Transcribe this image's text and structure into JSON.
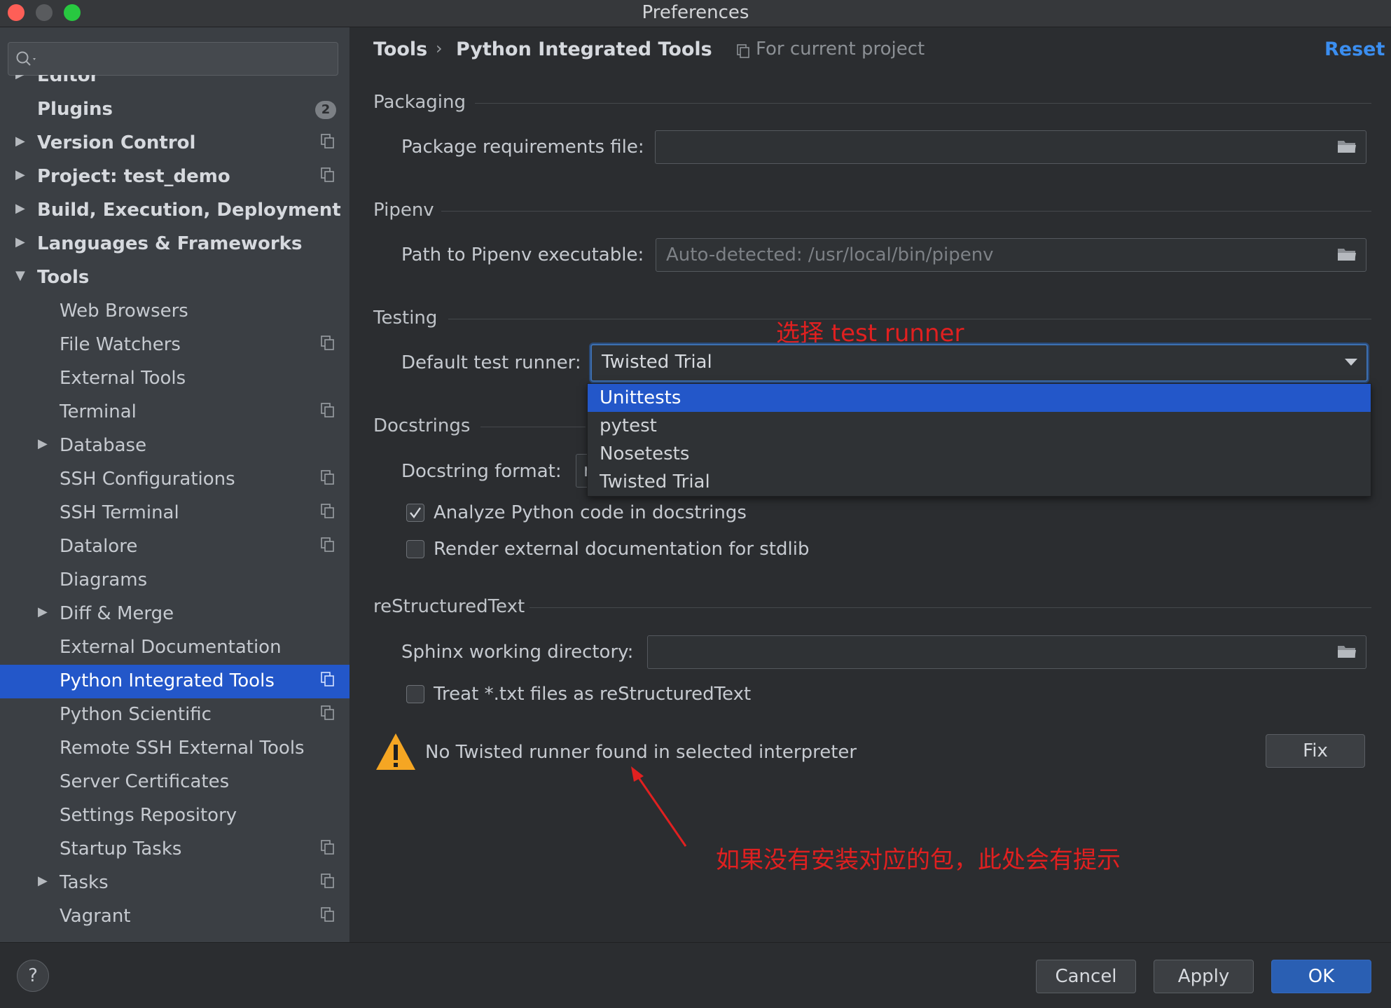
{
  "window": {
    "title": "Preferences"
  },
  "colors": {
    "accent": "#2357c9",
    "link": "#3b8ef0",
    "annotation": "#e02020",
    "warning": "#f5a623"
  },
  "sidebar": {
    "search_placeholder": "",
    "items": [
      {
        "label": "Editor",
        "bold": true,
        "arrow": "collapsed",
        "project_icon": false
      },
      {
        "label": "Plugins",
        "bold": true,
        "arrow": "none",
        "badge": "2"
      },
      {
        "label": "Version Control",
        "bold": true,
        "arrow": "collapsed",
        "project_icon": true
      },
      {
        "label": "Project: test_demo",
        "bold": true,
        "arrow": "collapsed",
        "project_icon": true
      },
      {
        "label": "Build, Execution, Deployment",
        "bold": true,
        "arrow": "collapsed",
        "project_icon": false
      },
      {
        "label": "Languages & Frameworks",
        "bold": true,
        "arrow": "collapsed",
        "project_icon": false
      },
      {
        "label": "Tools",
        "bold": true,
        "arrow": "expanded",
        "project_icon": false
      },
      {
        "label": "Web Browsers",
        "arrow": "none",
        "project_icon": false
      },
      {
        "label": "File Watchers",
        "arrow": "none",
        "project_icon": true
      },
      {
        "label": "External Tools",
        "arrow": "none",
        "project_icon": false
      },
      {
        "label": "Terminal",
        "arrow": "none",
        "project_icon": true
      },
      {
        "label": "Database",
        "arrow": "collapsed",
        "project_icon": false
      },
      {
        "label": "SSH Configurations",
        "arrow": "none",
        "project_icon": true
      },
      {
        "label": "SSH Terminal",
        "arrow": "none",
        "project_icon": true
      },
      {
        "label": "Datalore",
        "arrow": "none",
        "project_icon": true
      },
      {
        "label": "Diagrams",
        "arrow": "none",
        "project_icon": false
      },
      {
        "label": "Diff & Merge",
        "arrow": "collapsed",
        "project_icon": false
      },
      {
        "label": "External Documentation",
        "arrow": "none",
        "project_icon": false
      },
      {
        "label": "Python Integrated Tools",
        "arrow": "none",
        "project_icon": true,
        "selected": true
      },
      {
        "label": "Python Scientific",
        "arrow": "none",
        "project_icon": true
      },
      {
        "label": "Remote SSH External Tools",
        "arrow": "none",
        "project_icon": false
      },
      {
        "label": "Server Certificates",
        "arrow": "none",
        "project_icon": false
      },
      {
        "label": "Settings Repository",
        "arrow": "none",
        "project_icon": false
      },
      {
        "label": "Startup Tasks",
        "arrow": "none",
        "project_icon": true
      },
      {
        "label": "Tasks",
        "arrow": "collapsed",
        "project_icon": true
      },
      {
        "label": "Vagrant",
        "arrow": "none",
        "project_icon": true
      }
    ]
  },
  "header": {
    "breadcrumb_parent": "Tools",
    "breadcrumb_sep": "›",
    "breadcrumb_current": "Python Integrated Tools",
    "scope": "For current project",
    "reset": "Reset"
  },
  "packaging": {
    "title": "Packaging",
    "req_label": "Package requirements file:",
    "req_value": ""
  },
  "pipenv": {
    "title": "Pipenv",
    "path_label": "Path to Pipenv executable:",
    "path_placeholder": "Auto-detected: /usr/local/bin/pipenv"
  },
  "testing": {
    "title": "Testing",
    "runner_label": "Default test runner:",
    "runner_value": "Twisted Trial",
    "options": [
      "Unittests",
      "pytest",
      "Nosetests",
      "Twisted Trial"
    ],
    "highlighted_option": "Unittests"
  },
  "docstrings": {
    "title": "Docstrings",
    "format_label": "Docstring format:",
    "format_value": "r",
    "analyze_label": "Analyze Python code in docstrings",
    "analyze_checked": true,
    "render_label": "Render external documentation for stdlib",
    "render_checked": false
  },
  "rest": {
    "title": "reStructuredText",
    "sphinx_label": "Sphinx working directory:",
    "sphinx_value": "",
    "treat_label": "Treat *.txt files as reStructuredText",
    "treat_checked": false
  },
  "warning": {
    "message": "No Twisted runner found in selected interpreter",
    "fix": "Fix"
  },
  "annotations": {
    "select_runner": "选择 test runner",
    "hint": "如果没有安装对应的包，此处会有提示"
  },
  "footer": {
    "help": "?",
    "cancel": "Cancel",
    "apply": "Apply",
    "ok": "OK"
  }
}
